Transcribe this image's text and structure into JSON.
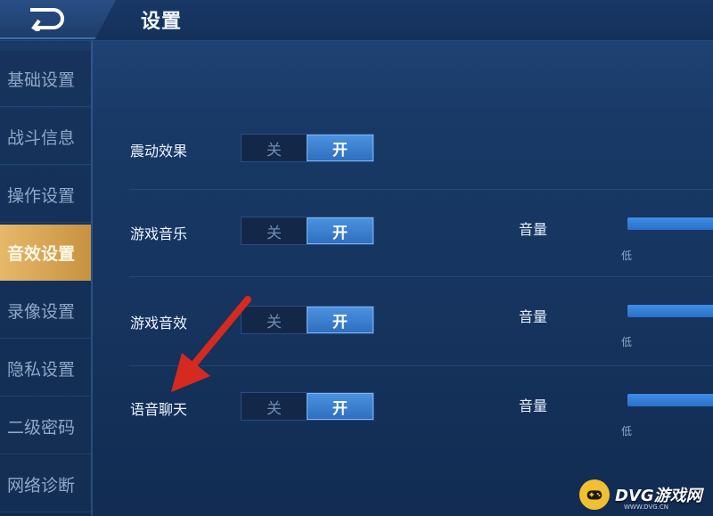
{
  "header": {
    "title": "设置",
    "back_icon": "back-arrow-icon"
  },
  "sidebar": {
    "items": [
      {
        "label": "基础设置",
        "active": false
      },
      {
        "label": "战斗信息",
        "active": false
      },
      {
        "label": "操作设置",
        "active": false
      },
      {
        "label": "音效设置",
        "active": true
      },
      {
        "label": "录像设置",
        "active": false
      },
      {
        "label": "隐私设置",
        "active": false
      },
      {
        "label": "二级密码",
        "active": false
      },
      {
        "label": "网络诊断",
        "active": false
      }
    ]
  },
  "settings": {
    "rows": [
      {
        "label": "震动效果",
        "off_label": "关",
        "on_label": "开",
        "selected": "开"
      },
      {
        "label": "游戏音乐",
        "off_label": "关",
        "on_label": "开",
        "selected": "开",
        "volume_label": "音量",
        "low_label": "低"
      },
      {
        "label": "游戏音效",
        "off_label": "关",
        "on_label": "开",
        "selected": "开",
        "volume_label": "音量",
        "low_label": "低"
      },
      {
        "label": "语音聊天",
        "off_label": "关",
        "on_label": "开",
        "selected": "开",
        "volume_label": "音量",
        "low_label": "低"
      }
    ]
  },
  "annotation": {
    "color": "#d42a20",
    "icon": "red-arrow-icon"
  },
  "watermark": {
    "text": "DVG游戏网",
    "sub": "WWW.DVG.CN",
    "logo_color": "#f0c030"
  },
  "colors": {
    "accent": "#3f8ee6",
    "active_tab": "#e6b86a"
  }
}
